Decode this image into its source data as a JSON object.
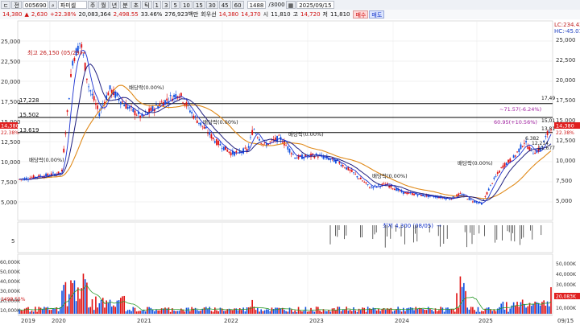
{
  "toolbar": {
    "mode_btn": "ㄷ",
    "mode_btn2": "전",
    "code": "005690",
    "search_icon": "search-icon",
    "stock_name": "파미셀",
    "periods": [
      "주",
      "월",
      "년",
      "분",
      "초",
      "틱"
    ],
    "minutes": [
      "1",
      "3",
      "5",
      "10",
      "15",
      "30",
      "45",
      "60"
    ],
    "count": "1488",
    "count_total": "/3000",
    "date": "2025/09/15"
  },
  "quote": {
    "prev": "14,380",
    "change": "2,630",
    "change_pct": "+22.38%",
    "volume": "20,083,364",
    "amount": "2,498.55",
    "turnover": "33.46%",
    "value": "276,923백만",
    "pref": "회우선",
    "p1": "14,380",
    "p2": "14,370",
    "open_label": "시",
    "open": "11,810",
    "high_label": "고",
    "high": "14,720",
    "low_label": "저",
    "low": "11,810",
    "buy": "매수",
    "sell": "매도"
  },
  "price_axis": {
    "ticks": [
      "25,000",
      "22,500",
      "20,000",
      "17,500",
      "15,000",
      "12,500",
      "10,000",
      "7,500",
      "5,000"
    ],
    "tick_values": [
      25000,
      22500,
      20000,
      17500,
      15000,
      12500,
      10000,
      7500,
      5000
    ],
    "right_top": [
      "LC:234.42",
      "HC:-45.01"
    ],
    "current_left": "14,380",
    "current_left2": "22.38%",
    "current_right": "14,380",
    "current_right2": "22.38%",
    "hlines": [
      {
        "label": "17,228",
        "value": 17228
      },
      {
        "label": "15,502",
        "value": 15502
      },
      {
        "label": "13,619",
        "value": 13619
      }
    ],
    "right_marks": [
      "17,49",
      "15,01",
      "13,81"
    ]
  },
  "annotations": {
    "high": "최고 26,150 (05/29)",
    "low": "최저 4,300 (08/05)",
    "dividends": [
      "배당락(0.00%)",
      "배당락(0.00%)",
      "배당락(0.00%)",
      "배당락(0.00%)",
      "배당락(0.00%)",
      "배당락(0.00%)"
    ],
    "stats_a": "~71.57(-6.24%)",
    "stats_b": "60.95(+10.56%)",
    "mini": [
      "6.382",
      "12,214",
      "11,677"
    ]
  },
  "volume_axis": {
    "ticks": [
      "60,000K",
      "50,000K",
      "40,000K",
      "30,000K",
      "20,000K",
      "10,000K"
    ],
    "current": "20,083K",
    "current2": "2498.55%"
  },
  "x_axis": {
    "years": [
      "2019",
      "2020",
      "2021",
      "2022",
      "2023",
      "2024",
      "2025"
    ],
    "last": "09/15"
  },
  "signal_panel": {
    "label": "5"
  },
  "colors": {
    "ma5": "#1a2fd0",
    "ma20": "#e08a1a",
    "ma_dark": "#202080",
    "up": "#e01010",
    "down": "#1050e0",
    "hline": "#000000"
  }
}
